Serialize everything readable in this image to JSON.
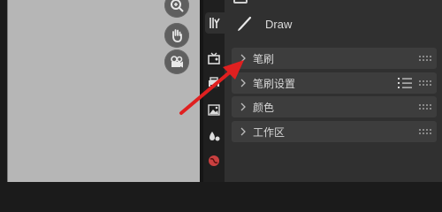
{
  "header": {
    "title": "Draw"
  },
  "panels": [
    {
      "label": "笔刷"
    },
    {
      "label": "笔刷设置"
    },
    {
      "label": "颜色"
    },
    {
      "label": "工作区"
    }
  ],
  "colors": {
    "annotation_arrow": "#e02020",
    "panel_bg": "#3d3d3d",
    "editor_bg": "#303030",
    "viewport_bg": "#b6b6b6"
  },
  "icons": [
    "zoom-icon",
    "hand-icon",
    "camera-icon",
    "tool-settings-icon",
    "render-icon",
    "output-icon",
    "view-layer-icon",
    "scene-icon",
    "world-icon",
    "brush-icon"
  ]
}
